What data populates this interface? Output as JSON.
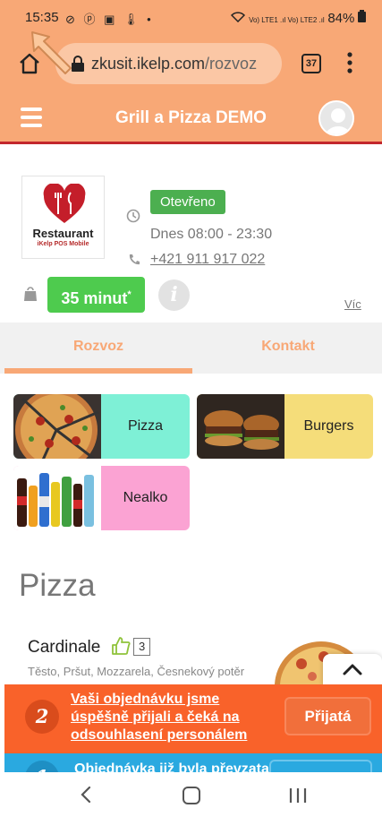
{
  "status_bar": {
    "time": "15:35",
    "left_icons": "⊘ ⓟ ▣ 🌡 •",
    "network": "Vo) LTE1 .ıl Vo) LTE2 .ıl",
    "battery": "84%"
  },
  "browser": {
    "url_domain": "zkusit.ikelp.com",
    "url_path": "/rozvoz",
    "tab_count": "37"
  },
  "header": {
    "title": "Grill a Pizza DEMO"
  },
  "restaurant": {
    "logo_name": "Restaurant",
    "logo_sub": "iKelp POS Mobile",
    "status": "Otevřeno",
    "hours": "Dnes 08:00 - 23:30",
    "phone": "+421 911 917 022",
    "delivery_time": "35 minut",
    "delivery_time_mark": "*",
    "info_glyph": "i",
    "more_label": "Víc"
  },
  "tabs": [
    {
      "label": "Rozvoz"
    },
    {
      "label": "Kontakt"
    }
  ],
  "categories": [
    {
      "label": "Pizza",
      "color": "#7ef0d6"
    },
    {
      "label": "Burgers",
      "color": "#f5dd7a"
    },
    {
      "label": "Nealko",
      "color": "#fba3d3"
    }
  ],
  "section": {
    "title": "Pizza"
  },
  "item": {
    "name": "Cardinale",
    "likes": "3",
    "description": "Těsto, Pršut, Mozzarela, Česnekový potěr"
  },
  "notification": {
    "number": "2",
    "text": "Vaši objednávku jsme úspěšně přijali a čeká na odsouhlasení personálem",
    "button_label": "Přijatá"
  },
  "notification2": {
    "number": "1",
    "text": "Objednávka již byla převzata"
  },
  "colors": {
    "brand_orange": "#f8a876",
    "accent_red": "#c2272d",
    "open_green": "#4caf50",
    "time_green": "#4ecb4e",
    "notify_orange": "#f9622a",
    "notify_blue": "#2aa9e0"
  }
}
